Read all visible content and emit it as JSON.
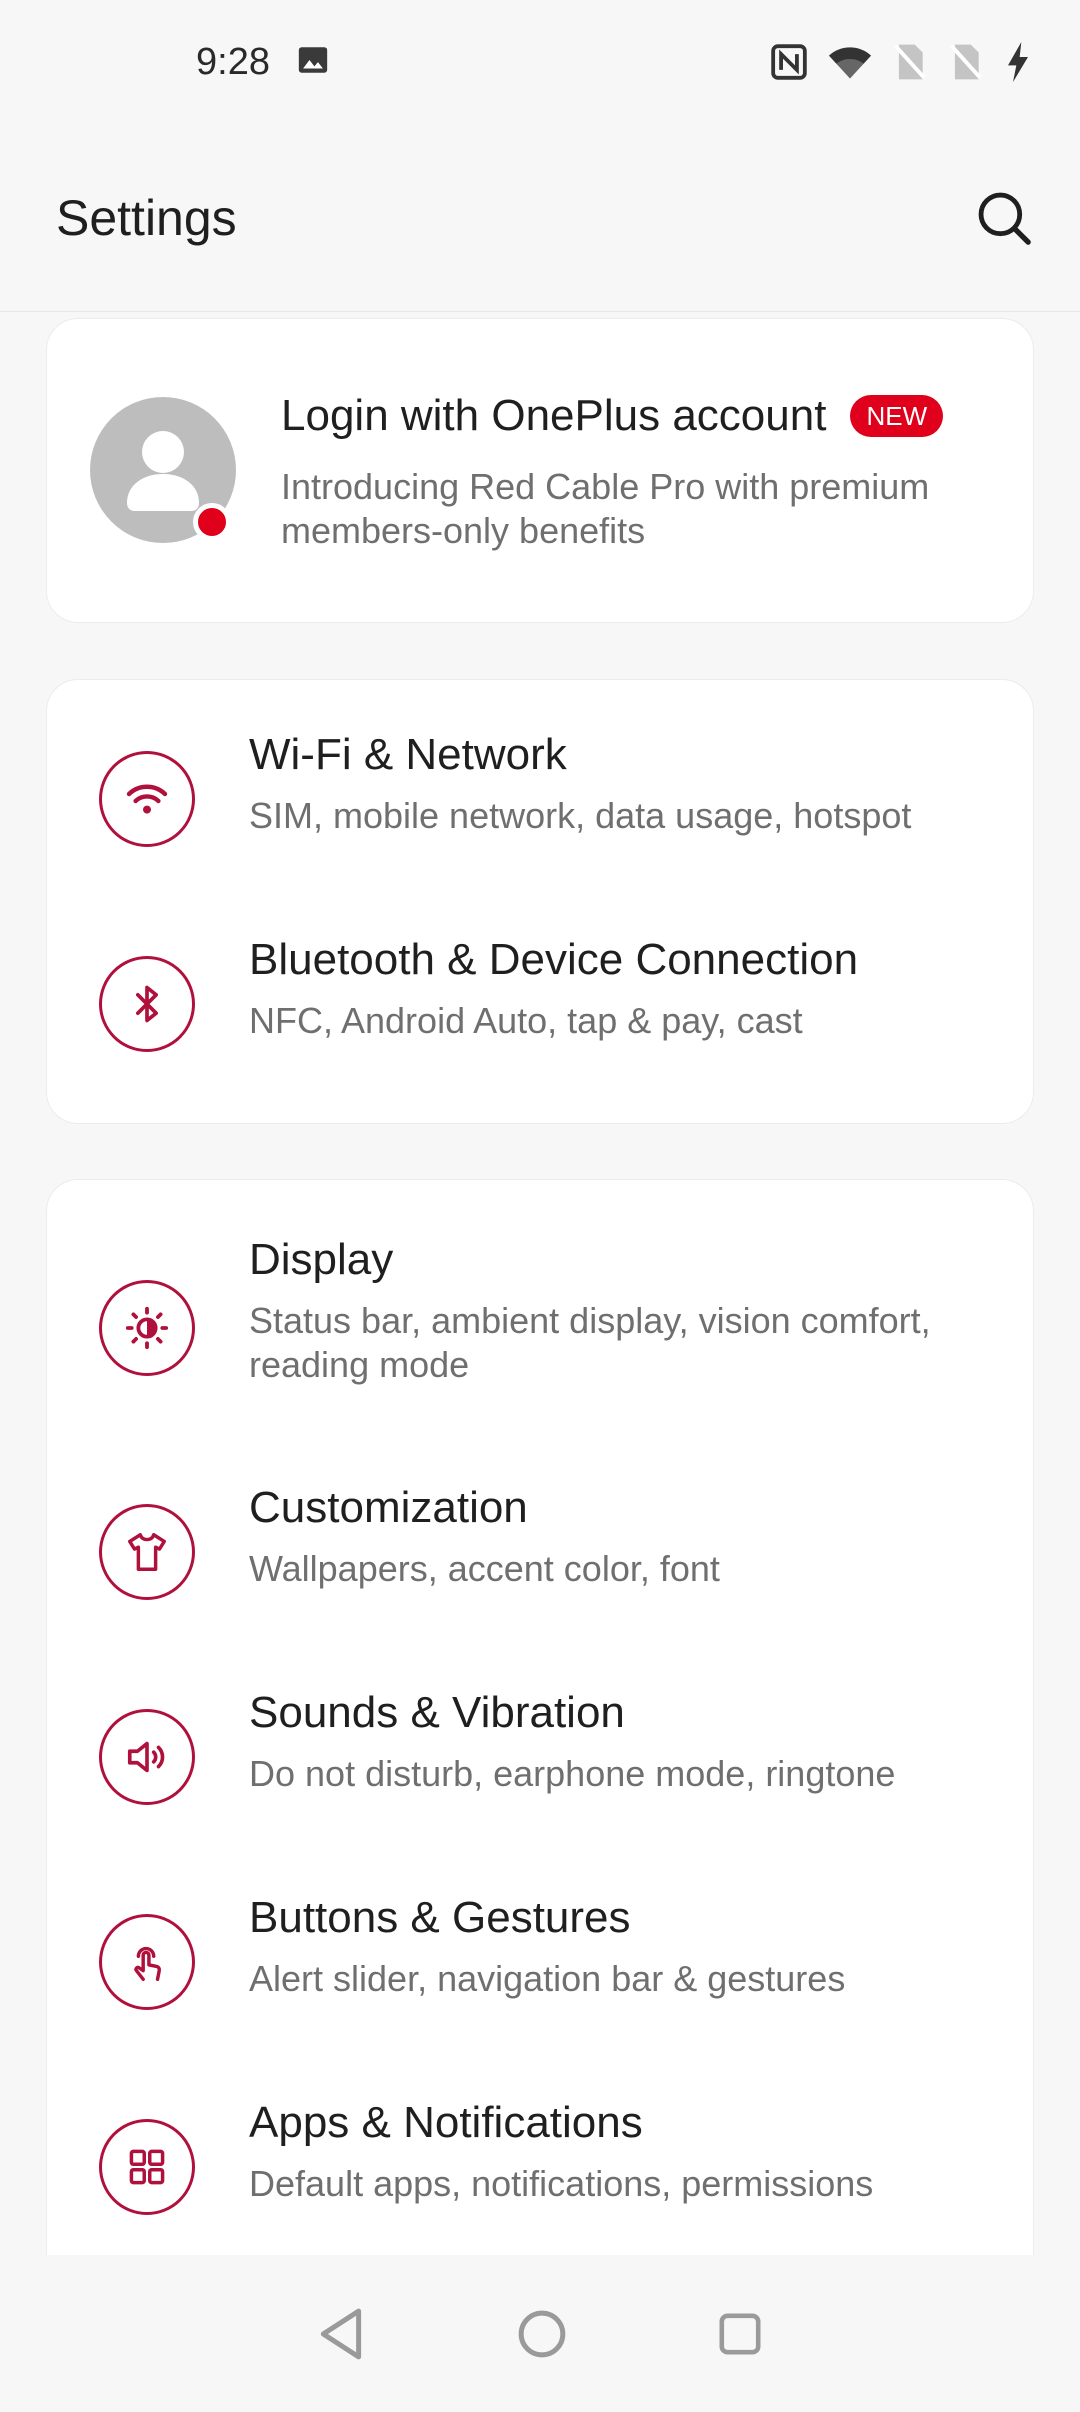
{
  "status_bar": {
    "time": "9:28",
    "icons": [
      "image-icon",
      "nfc-icon",
      "wifi-icon",
      "no-sim-icon",
      "no-sim-icon",
      "charging-icon"
    ]
  },
  "header": {
    "title": "Settings",
    "search_icon": "search-icon"
  },
  "account": {
    "title": "Login with OnePlus account",
    "badge": "NEW",
    "subtitle": "Introducing Red Cable Pro with premium members-only benefits"
  },
  "groups": [
    {
      "items": [
        {
          "title": "Wi-Fi & Network",
          "subtitle": "SIM, mobile network, data usage, hotspot",
          "icon": "wifi-icon"
        },
        {
          "title": "Bluetooth & Device Connection",
          "subtitle": "NFC, Android Auto, tap & pay, cast",
          "icon": "bluetooth-icon"
        }
      ]
    },
    {
      "items": [
        {
          "title": "Display",
          "subtitle": "Status bar, ambient display, vision comfort, reading mode",
          "icon": "brightness-icon"
        },
        {
          "title": "Customization",
          "subtitle": "Wallpapers, accent color, font",
          "icon": "tshirt-icon"
        },
        {
          "title": "Sounds & Vibration",
          "subtitle": "Do not disturb, earphone mode, ringtone",
          "icon": "speaker-icon"
        },
        {
          "title": "Buttons & Gestures",
          "subtitle": "Alert slider, navigation bar & gestures",
          "icon": "gesture-icon"
        },
        {
          "title": "Apps & Notifications",
          "subtitle": "Default apps, notifications, permissions",
          "icon": "apps-grid-icon"
        }
      ]
    }
  ],
  "navigation": {
    "back_icon": "back-icon",
    "home_icon": "home-icon",
    "recents_icon": "recents-icon"
  },
  "colors": {
    "accent": "#b0103c",
    "badge": "#e0001b",
    "background": "#f7f7f7",
    "card": "#ffffff",
    "primary_text": "#1f1f1f",
    "secondary_text": "#6f6f6f"
  }
}
